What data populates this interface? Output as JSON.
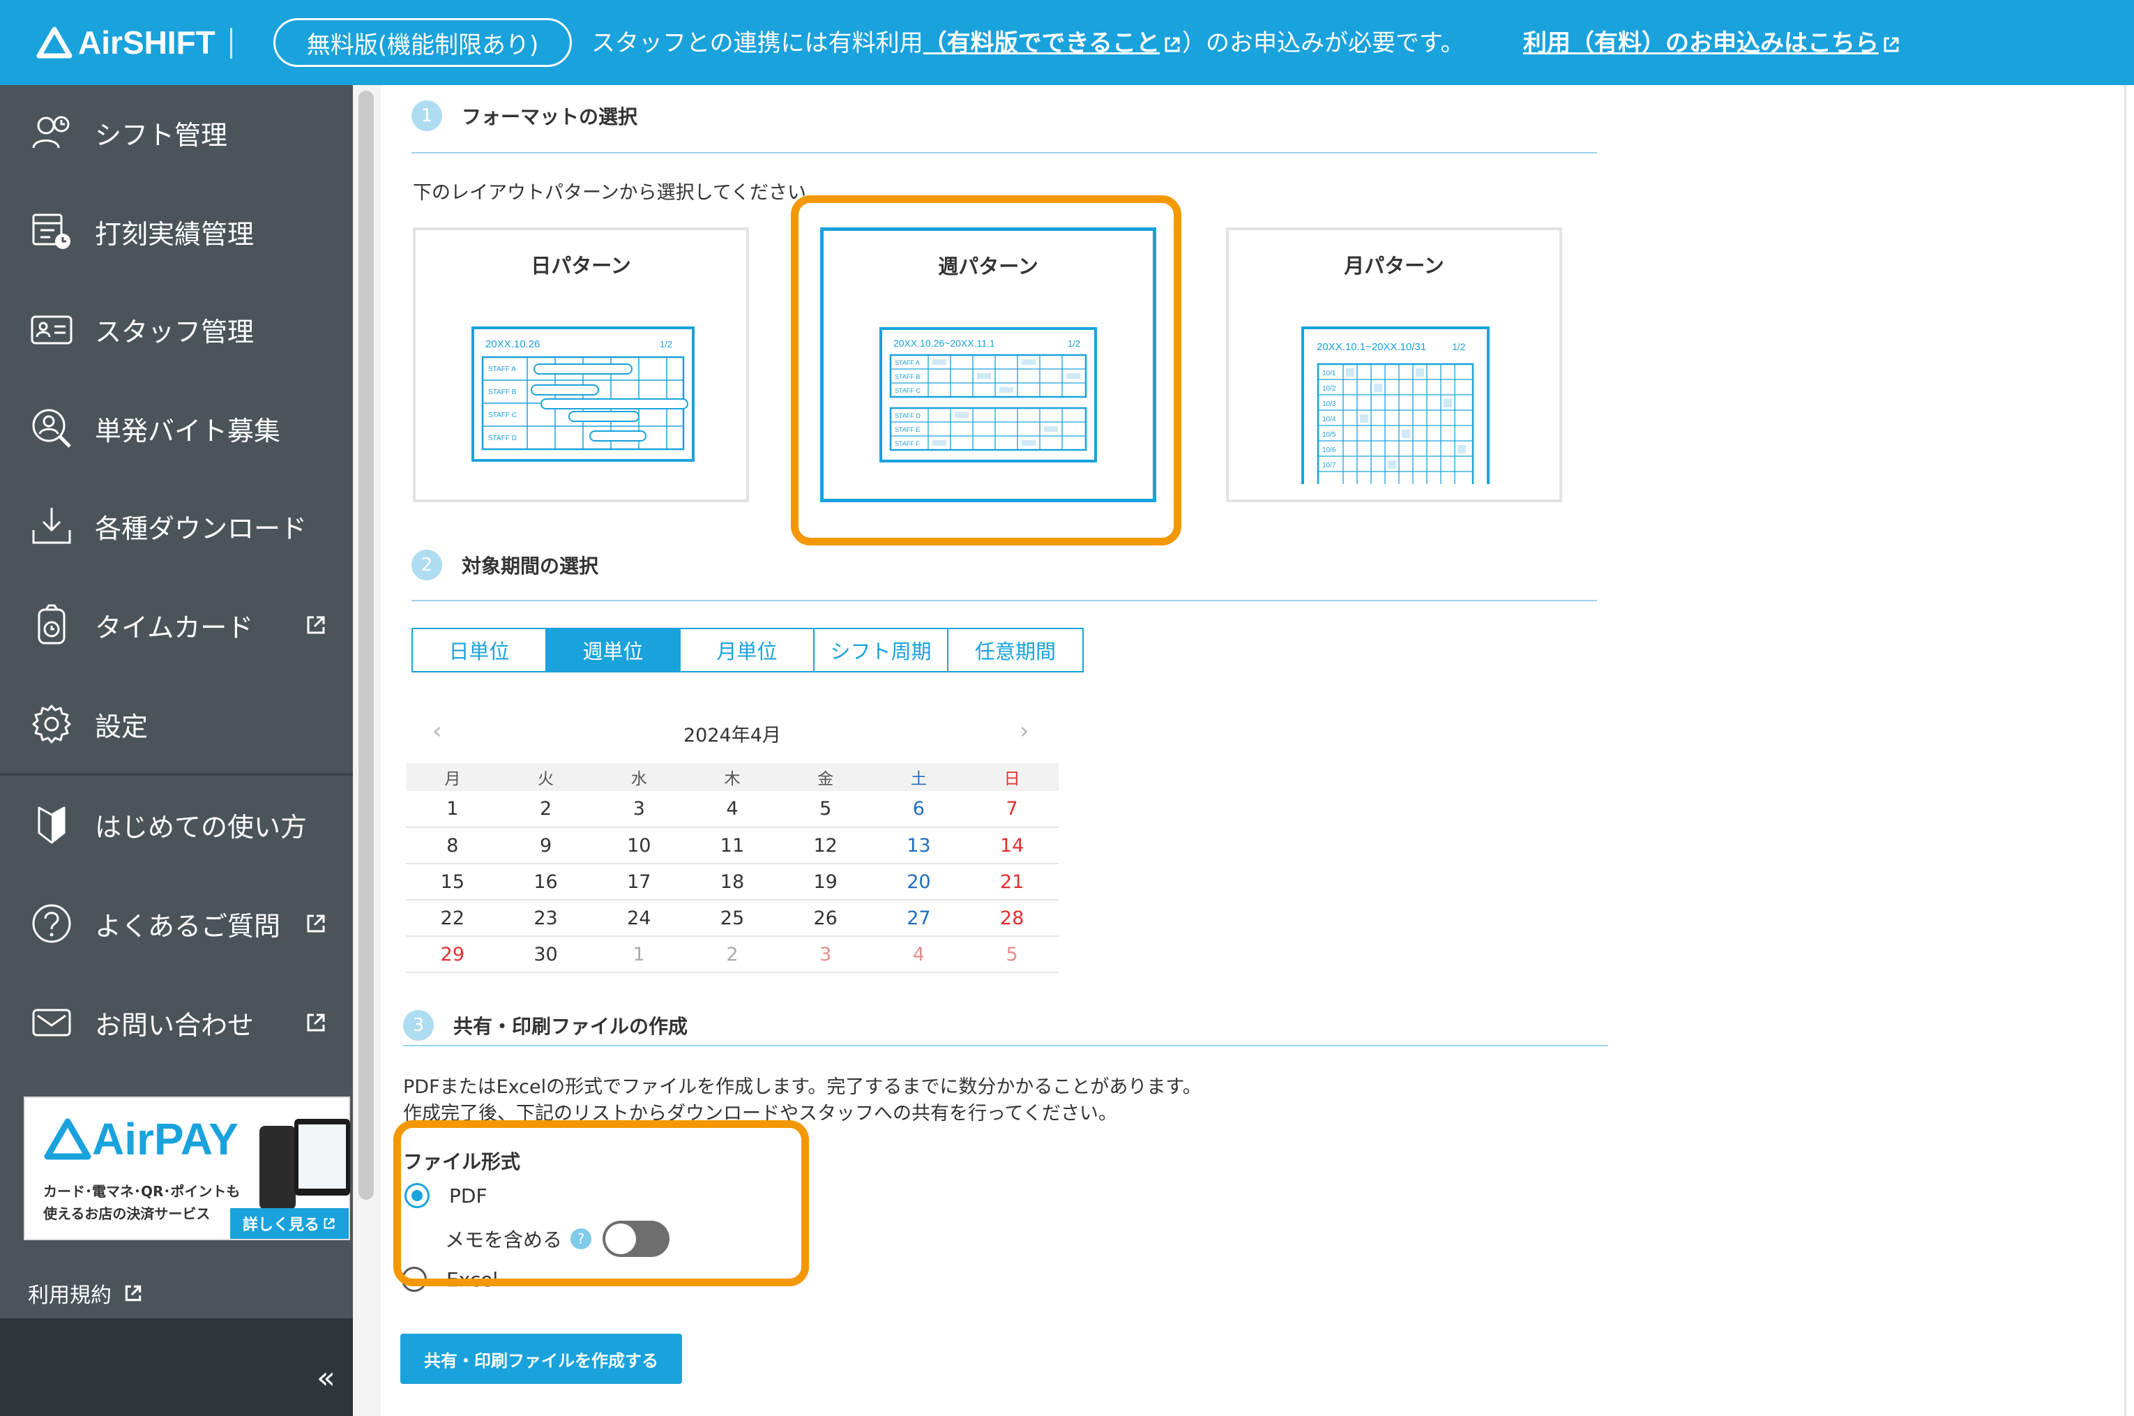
{
  "topbar": {
    "logo": "AirSHIFT",
    "plan_badge": "無料版(機能制限あり)",
    "notice_pre": "スタッフとの連携には有料利用",
    "notice_link": "（有料版でできること",
    "notice_post": "）のお申込みが必要です。",
    "apply_link": "利用（有料）のお申込みはこちら",
    "accent": "#1aa2dc"
  },
  "sidebar": {
    "items": [
      {
        "label": "シフト管理",
        "icon": "staff-shift-icon"
      },
      {
        "label": "打刻実績管理",
        "icon": "timesheet-clock-icon"
      },
      {
        "label": "スタッフ管理",
        "icon": "id-card-icon"
      },
      {
        "label": "単発バイト募集",
        "icon": "person-search-icon"
      },
      {
        "label": "各種ダウンロード",
        "icon": "download-icon"
      },
      {
        "label": "タイムカード",
        "icon": "timecard-icon",
        "external": true
      },
      {
        "label": "設定",
        "icon": "gear-icon"
      },
      {
        "label": "はじめての使い方",
        "icon": "beginner-mark-icon"
      },
      {
        "label": "よくあるご質問",
        "icon": "question-icon",
        "external": true
      },
      {
        "label": "お問い合わせ",
        "icon": "mail-icon",
        "external": true
      }
    ],
    "ad": {
      "brand": "AirPAY",
      "tagline_1": "カード･電マネ･QR･ポイントも",
      "tagline_2": "使えるお店の決済サービス",
      "more": "詳しく見る"
    },
    "terms": "利用規約",
    "collapse": "«"
  },
  "section1": {
    "num": "1",
    "title": "フォーマットの選択",
    "desc": "下のレイアウトパターンから選択してください",
    "cards": [
      {
        "title": "日パターン",
        "preview_date": "20XX.10.26",
        "preview_page": "1/2",
        "staff": [
          "STAFF A",
          "STAFF B",
          "STAFF C",
          "STAFF D"
        ]
      },
      {
        "title": "週パターン",
        "preview_date": "20XX.10.26~20XX.11.1",
        "preview_page": "1/2",
        "staff": [
          "STAFF A",
          "STAFF B",
          "STAFF C",
          "STAFF D",
          "STAFF E",
          "STAFF F"
        ]
      },
      {
        "title": "月パターン",
        "preview_date": "20XX.10.1~20XX.10/31",
        "preview_page": "1/2",
        "days": [
          "10/1",
          "10/2",
          "10/3",
          "10/4",
          "10/5",
          "10/6",
          "10/7"
        ]
      }
    ],
    "selected": "週パターン"
  },
  "section2": {
    "num": "2",
    "title": "対象期間の選択",
    "tabs": [
      "日単位",
      "週単位",
      "月単位",
      "シフト周期",
      "任意期間"
    ],
    "active_tab": "週単位",
    "calendar": {
      "month": "2024年4月",
      "prev": "‹",
      "next": "›",
      "weekdays": [
        "月",
        "火",
        "水",
        "木",
        "金",
        "土",
        "日"
      ],
      "weeks": [
        [
          "1",
          "2",
          "3",
          "4",
          "5",
          "6",
          "7"
        ],
        [
          "8",
          "9",
          "10",
          "11",
          "12",
          "13",
          "14"
        ],
        [
          "15",
          "16",
          "17",
          "18",
          "19",
          "20",
          "21"
        ],
        [
          "22",
          "23",
          "24",
          "25",
          "26",
          "27",
          "28"
        ],
        [
          "29",
          "30",
          "1",
          "2",
          "3",
          "4",
          "5"
        ]
      ]
    }
  },
  "section3": {
    "num": "3",
    "title": "共有・印刷ファイルの作成",
    "desc_1": "PDFまたはExcelの形式でファイルを作成します。完了するまでに数分かかることがあります。",
    "desc_2": "作成完了後、下記のリストからダウンロードやスタッフへの共有を行ってください。",
    "file_format_label": "ファイル形式",
    "options": [
      "PDF",
      "Excel"
    ],
    "selected_option": "PDF",
    "memo_label": "メモを含める",
    "memo_help": "?",
    "memo_enabled": false,
    "create_button": "共有・印刷ファイルを作成する"
  },
  "highlight_color": "#f39800"
}
